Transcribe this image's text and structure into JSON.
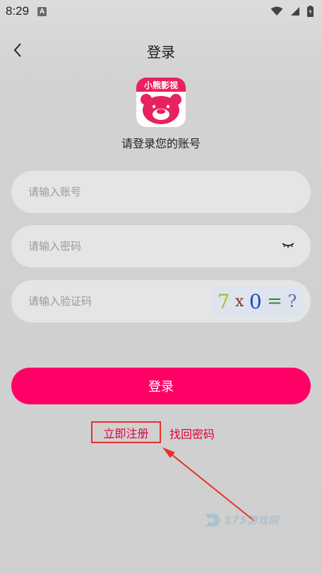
{
  "status_bar": {
    "time": "8:29",
    "notification_badge": "A"
  },
  "header": {
    "title": "登录",
    "back_icon": "chevron-left-icon"
  },
  "app": {
    "logo_text": "小熊影视",
    "prompt": "请登录您的账号"
  },
  "form": {
    "account_placeholder": "请输入账号",
    "password_placeholder": "请输入密码",
    "captcha_placeholder": "请输入验证码",
    "captcha_chars": [
      "7",
      "x",
      "0",
      "=",
      "?"
    ],
    "captcha_colors": [
      "#a8c020",
      "#8a2a2a",
      "#1a48c8",
      "#2a8a3a",
      "#6a6aa8"
    ],
    "password_toggle_icon": "eye-closed-icon"
  },
  "actions": {
    "login_label": "登录",
    "register_label": "立即注册",
    "forgot_label": "找回密码"
  },
  "watermark": {
    "text": "175游戏网"
  },
  "colors": {
    "accent": "#ff0066",
    "link": "#e0003c",
    "annotation": "#e8302a"
  }
}
